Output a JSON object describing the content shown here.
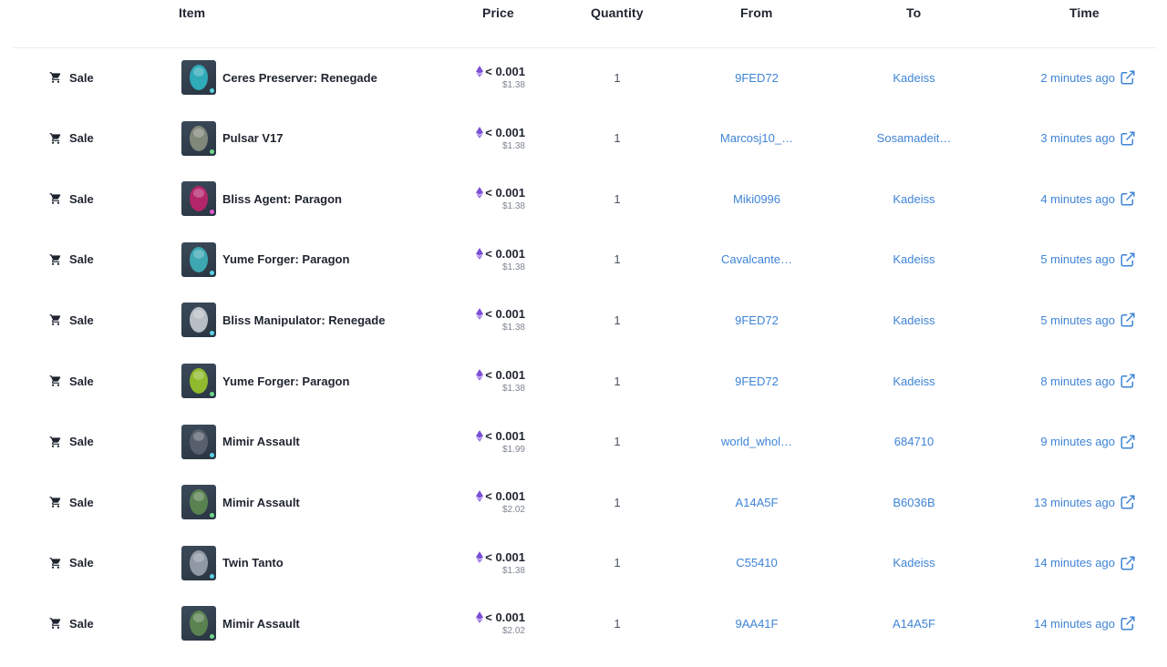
{
  "header": {
    "item": "Item",
    "price": "Price",
    "quantity": "Quantity",
    "from": "From",
    "to": "To",
    "time": "Time"
  },
  "colors": {
    "link": "#3f84d6",
    "text": "#1f2430",
    "muted": "#7d8592",
    "eth": "#7b4fd6"
  },
  "rows": [
    {
      "event": "Sale",
      "item": "Ceres Preserver: Renegade",
      "thumb_color": "#2fb6c4",
      "rarity_dot": "#5ad1e6",
      "price_eth": "< 0.001",
      "price_usd": "$1.38",
      "quantity": "1",
      "from": "9FED72",
      "to": "Kadeiss",
      "time": "2 minutes ago",
      "icon": "external-link-icon"
    },
    {
      "event": "Sale",
      "item": "Pulsar V17",
      "thumb_color": "#8a9080",
      "rarity_dot": "#6cd88a",
      "price_eth": "< 0.001",
      "price_usd": "$1.38",
      "quantity": "1",
      "from": "Marcosj10_…",
      "to": "Sosamadeit…",
      "time": "3 minutes ago",
      "icon": "external-link-icon"
    },
    {
      "event": "Sale",
      "item": "Bliss Agent: Paragon",
      "thumb_color": "#c2246e",
      "rarity_dot": "#e05bd0",
      "price_eth": "< 0.001",
      "price_usd": "$1.38",
      "quantity": "1",
      "from": "Miki0996",
      "to": "Kadeiss",
      "time": "4 minutes ago",
      "icon": "external-link-icon"
    },
    {
      "event": "Sale",
      "item": "Yume Forger: Paragon",
      "thumb_color": "#3fb3bd",
      "rarity_dot": "#5ad1e6",
      "price_eth": "< 0.001",
      "price_usd": "$1.38",
      "quantity": "1",
      "from": "Cavalcante…",
      "to": "Kadeiss",
      "time": "5 minutes ago",
      "icon": "external-link-icon"
    },
    {
      "event": "Sale",
      "item": "Bliss Manipulator: Renegade",
      "thumb_color": "#c7ccd2",
      "rarity_dot": "#5ad1e6",
      "price_eth": "< 0.001",
      "price_usd": "$1.38",
      "quantity": "1",
      "from": "9FED72",
      "to": "Kadeiss",
      "time": "5 minutes ago",
      "icon": "external-link-icon"
    },
    {
      "event": "Sale",
      "item": "Yume Forger: Paragon",
      "thumb_color": "#9ac82a",
      "rarity_dot": "#6cd88a",
      "price_eth": "< 0.001",
      "price_usd": "$1.38",
      "quantity": "1",
      "from": "9FED72",
      "to": "Kadeiss",
      "time": "8 minutes ago",
      "icon": "external-link-icon"
    },
    {
      "event": "Sale",
      "item": "Mimir Assault",
      "thumb_color": "#5c6470",
      "rarity_dot": "#5ad1e6",
      "price_eth": "< 0.001",
      "price_usd": "$1.99",
      "quantity": "1",
      "from": "world_whol…",
      "to": "684710",
      "time": "9 minutes ago",
      "icon": "external-link-icon"
    },
    {
      "event": "Sale",
      "item": "Mimir Assault",
      "thumb_color": "#5f8a52",
      "rarity_dot": "#6cd88a",
      "price_eth": "< 0.001",
      "price_usd": "$2.02",
      "quantity": "1",
      "from": "A14A5F",
      "to": "B6036B",
      "time": "13 minutes ago",
      "icon": "external-link-icon"
    },
    {
      "event": "Sale",
      "item": "Twin Tanto",
      "thumb_color": "#9aa3ad",
      "rarity_dot": "#5ad1e6",
      "price_eth": "< 0.001",
      "price_usd": "$1.38",
      "quantity": "1",
      "from": "C55410",
      "to": "Kadeiss",
      "time": "14 minutes ago",
      "icon": "external-link-icon"
    },
    {
      "event": "Sale",
      "item": "Mimir Assault",
      "thumb_color": "#5f8a52",
      "rarity_dot": "#6cd88a",
      "price_eth": "< 0.001",
      "price_usd": "$2.02",
      "quantity": "1",
      "from": "9AA41F",
      "to": "A14A5F",
      "time": "14 minutes ago",
      "icon": "external-link-icon"
    }
  ]
}
